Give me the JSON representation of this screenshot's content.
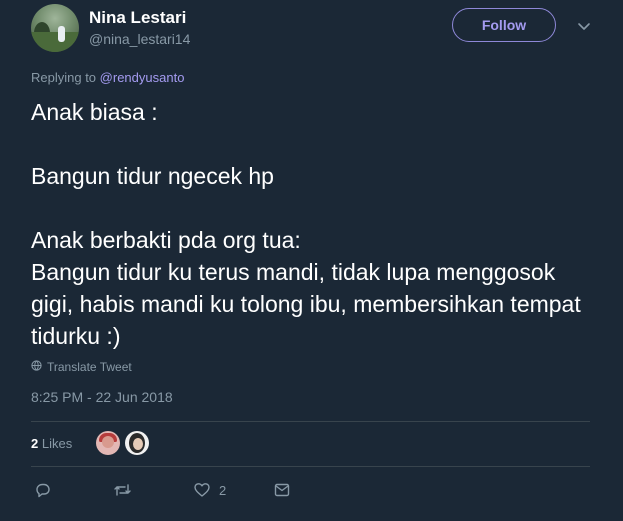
{
  "author": {
    "display_name": "Nina Lestari",
    "handle": "@nina_lestari14",
    "avatar_icon": "profile-photo"
  },
  "follow_button": {
    "label": "Follow"
  },
  "reply_context": {
    "prefix": "Replying to",
    "mention": "@rendyusanto"
  },
  "tweet": {
    "text": "Anak biasa :\n\nBangun tidur ngecek hp\n\nAnak berbakti pda org tua:\nBangun tidur ku terus mandi, tidak lupa menggosok gigi, habis mandi ku tolong ibu, membersihkan tempat tidurku :)",
    "translate_label": "Translate Tweet",
    "timestamp": "8:25 PM - 22 Jun 2018"
  },
  "stats": {
    "likes_count": "2",
    "likes_label": "Likes"
  },
  "actions": {
    "reply_icon": "reply-icon",
    "retweet_icon": "retweet-icon",
    "like_icon": "heart-icon",
    "like_count": "2",
    "dm_icon": "envelope-icon"
  },
  "colors": {
    "background": "#1b2836",
    "accent": "#a49bf0",
    "muted": "#8899a6",
    "divider": "#38444d"
  }
}
